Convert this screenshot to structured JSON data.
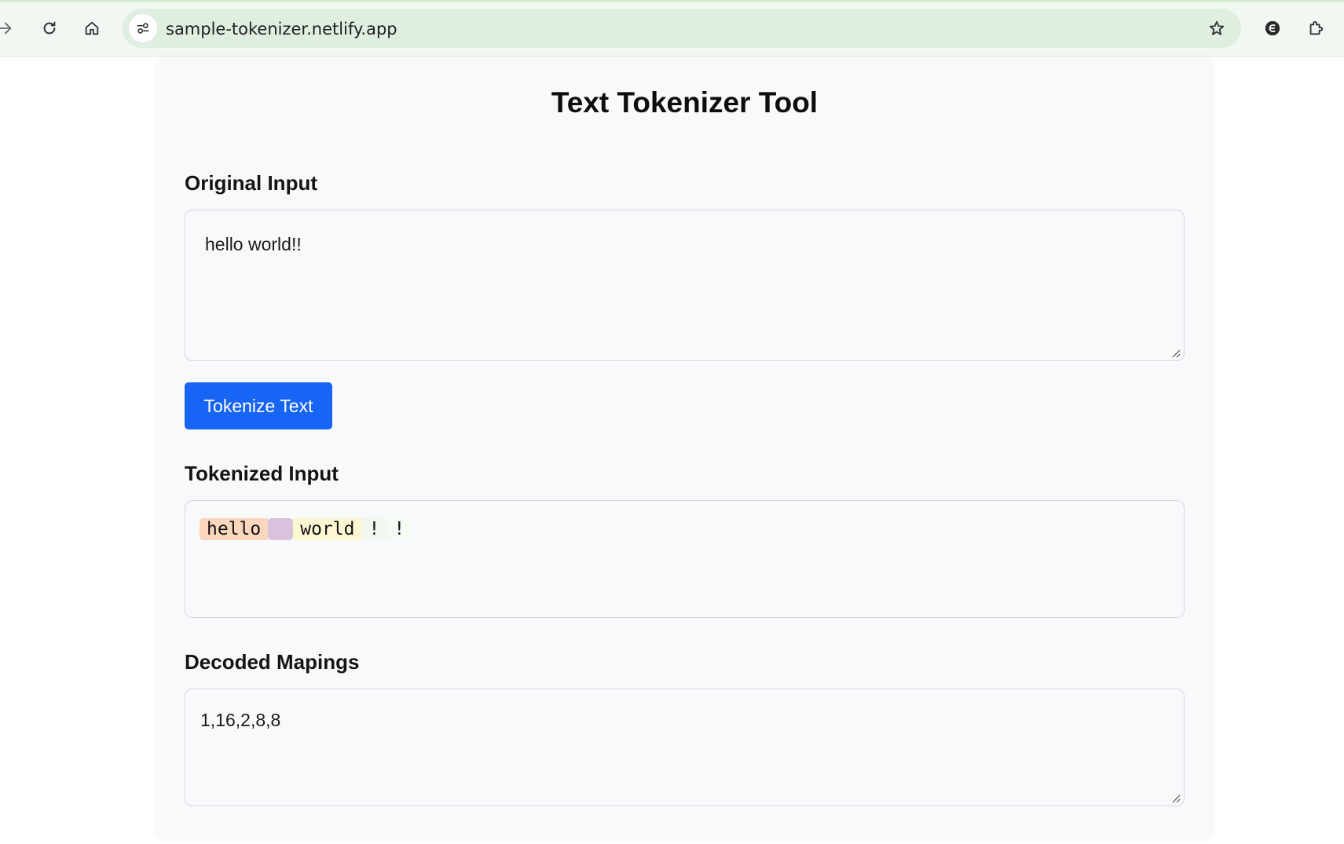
{
  "browser": {
    "url": "sample-tokenizer.netlify.app"
  },
  "page": {
    "title": "Text Tokenizer Tool",
    "original_label": "Original Input",
    "original_value": "hello world!!",
    "button_label": "Tokenize Text",
    "tokenized_label": "Tokenized Input",
    "tokens": [
      {
        "text": "hello",
        "color": "#fcd6bd"
      },
      {
        "text": " ",
        "color": "#d8c2dc"
      },
      {
        "text": "world",
        "color": "#fdf6d3"
      },
      {
        "text": "!",
        "color": "#f1f8ef"
      },
      {
        "text": "!",
        "color": "#f4fbf4"
      }
    ],
    "decoded_label": "Decoded Mapings",
    "decoded_value": "1,16,2,8,8"
  },
  "colors": {
    "accent": "#1864f5",
    "card_bg": "#f8f9fb",
    "chrome_bg": "#f1f8f1"
  }
}
